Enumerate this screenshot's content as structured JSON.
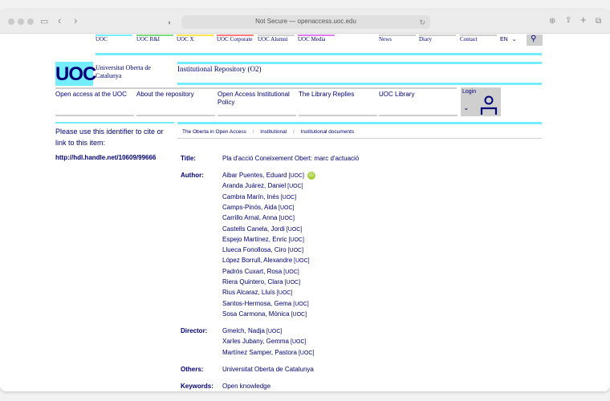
{
  "browser": {
    "url": "Not Secure — openaccess.uoc.edu"
  },
  "top_nav": [
    {
      "label": "UOC",
      "color": "#73edff"
    },
    {
      "label": "UOC R&I",
      "color": "#7cd87c"
    },
    {
      "label": "UOC X",
      "color": "#ffe34d"
    },
    {
      "label": "UOC Corporate",
      "color": "#ff7a7a"
    },
    {
      "label": "UOC Alumni",
      "color": "#cfcfcf"
    },
    {
      "label": "UOC Media",
      "color": "#e07cf0"
    },
    {
      "label": "",
      "color": "#ffffff"
    },
    {
      "label": "News",
      "color": "#cfcfcf"
    },
    {
      "label": "Diary",
      "color": "#cfcfcf"
    },
    {
      "label": "Contact",
      "color": "#cfcfcf"
    }
  ],
  "language": "EN",
  "logo": {
    "text": "UOC",
    "university_name": "Universitat Oberta de Catalunya"
  },
  "repository_title": "Institutional Repository (O2)",
  "main_nav": [
    "Open access at the UOC",
    "About the repository",
    "Open Access Institutional Policy",
    "The Library Replies",
    "UOC Library"
  ],
  "login_label": "Login",
  "cite_text": "Please use this identifier to cite or link to this item:",
  "handle": "http://hdl.handle.net/10609/99666",
  "breadcrumbs": [
    "The Oberta in Open Access",
    "Institutional",
    "Institutional documents"
  ],
  "record": {
    "title_label": "Title:",
    "title": "Pla d'acció Coneixement Obert: marc d'actuació",
    "author_label": "Author:",
    "authors": [
      "Aibar Puentes, Eduard",
      "Aranda Juárez, Daniel",
      "Cambra Marín, Inés",
      "Camps-Pinós, Aida",
      "Carrillo Arnal, Anna",
      "Castells Canela, Jordi",
      "Espejo Martínez, Enric",
      "Llueca Fonollosa, Ciro",
      "López Borrull, Alexandre",
      "Padrós Cuxart, Rosa",
      "Riera Quintero, Clara",
      "Rius Alcaraz, Lluís",
      "Santos-Hermosa, Gema",
      "Sosa Carmona, Mònica"
    ],
    "affiliation_tag": "[UOC]",
    "orcid_label": "iD",
    "director_label": "Director:",
    "directors": [
      "Gmelch, Nadja",
      "Xarles Jubany, Gemma",
      "Martínez Samper, Pastora"
    ],
    "others_label": "Others:",
    "others": "Universitat Oberta de Catalunya",
    "keywords_label": "Keywords:",
    "keywords": "Open knowledge"
  }
}
